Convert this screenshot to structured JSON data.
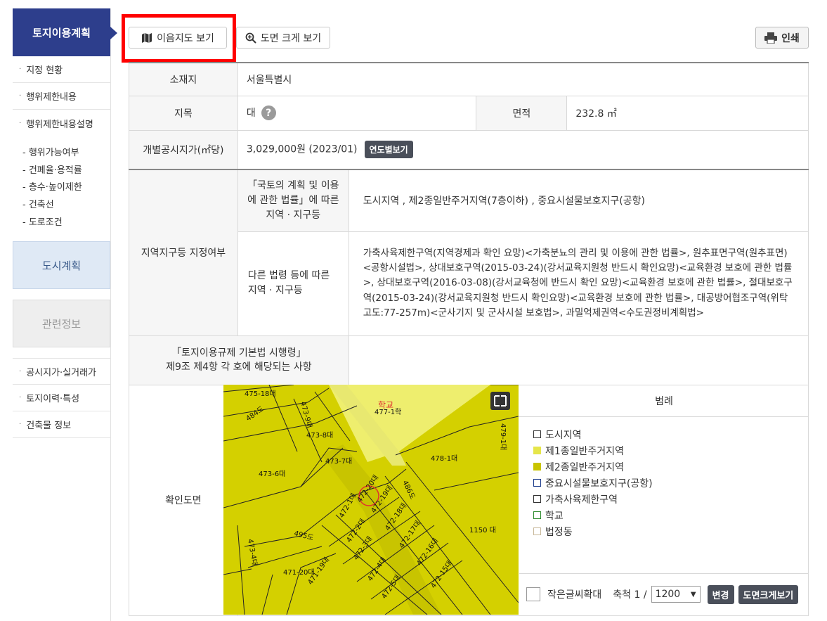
{
  "sidebar": {
    "header": "토지이용계획",
    "items_top": [
      "지정 현황",
      "행위제한내용",
      "행위제한내용설명"
    ],
    "sub_items": [
      "행위가능여부",
      "건폐율·용적률",
      "층수·높이제한",
      "건축선",
      "도로조건"
    ],
    "box_city": "도시계획",
    "box_related": "관련정보",
    "items_bottom": [
      "공시지가·실거래가",
      "토지이력·특성",
      "건축물 정보"
    ]
  },
  "toolbar": {
    "map_view": "이음지도 보기",
    "zoom_view": "도면 크게 보기",
    "print": "인쇄"
  },
  "table": {
    "loc_label": "소재지",
    "loc_value": "서울특별시",
    "jimok_label": "지목",
    "jimok_value": "대",
    "area_label": "면적",
    "area_value": "232.8 ㎡",
    "price_label": "개별공시지가(㎡당)",
    "price_value": "3,029,000원 (2023/01)",
    "price_button": "연도별보기",
    "zone_label": "지역지구등 지정여부",
    "law1_label": "「국토의 계획 및 이용에 관한 법률」에 따른 지역 · 지구등",
    "law1_value": "도시지역 , 제2종일반주거지역(7층이하) , 중요시설물보호지구(공항)",
    "law2_label": "다른 법령 등에 따른 지역 · 지구등",
    "law2_value": "가축사육제한구역(지역경제과 확인 요망)<가축분뇨의 관리 및 이용에 관한 법률>, 원추표면구역(원추표면)<공항시설법>, 상대보호구역(2015-03-24)(강서교육지원청 반드시 확인요망)<교육환경 보호에 관한 법률>, 상대보호구역(2016-03-08)(강서교육청에 반드시 확인 요망)<교육환경 보호에 관한 법률>, 절대보호구역(2015-03-24)(강서교육지원청 반드시 확인요망)<교육환경 보호에 관한 법률>, 대공방어협조구역(위탁고도:77-257m)<군사기지 및 군사시설 보호법>, 과밀억제권역<수도권정비계획법>",
    "rule_label_1": "「토지이용규제 기본법 시행령」",
    "rule_label_2": "제9조 제4항 각 호에 해당되는 사항",
    "rule_value": "",
    "map_label": "확인도면"
  },
  "legend": {
    "title": "범례",
    "items": [
      {
        "label": "도시지역",
        "color": "#ffffff",
        "border": "#333333"
      },
      {
        "label": "제1종일반주거지역",
        "color": "#e6e64a",
        "border": "#e6e64a"
      },
      {
        "label": "제2종일반주거지역",
        "color": "#c9c400",
        "border": "#c9c400"
      },
      {
        "label": "중요시설물보호지구(공항)",
        "color": "#ffffff",
        "border": "#1a3a8a"
      },
      {
        "label": "가축사육제한구역",
        "color": "#ffffff",
        "border": "#333333"
      },
      {
        "label": "학교",
        "color": "#ffffff",
        "border": "#2e8b2e"
      },
      {
        "label": "법정동",
        "color": "#ffffff",
        "border": "#c8b89a"
      }
    ],
    "small_text_zoom": "작은글씨확대",
    "scale_prefix": "축척 1 /",
    "scale_value": "1200",
    "change_button": "변경",
    "zoom_button": "도면크게보기"
  },
  "chart_data": {
    "type": "map",
    "map_labels": [
      "475-18대",
      "473-9대",
      "484도",
      "473-8대",
      "477-1학",
      "학교",
      "478-1대",
      "473-6대",
      "473-7대",
      "486도",
      "472-1대",
      "472-20대",
      "472-19대",
      "472-18대",
      "472-17대",
      "472-16대",
      "472-15대",
      "472-2대",
      "472-3대",
      "472-4대",
      "472-5대",
      "495도",
      "473-4대",
      "471-20대",
      "471-19대",
      "1150 대",
      "479-1대"
    ],
    "colors": {
      "zone2": "#d4d000",
      "zone1": "#eaea60",
      "road": "#e8e870",
      "line": "#222222",
      "marker": "#e03030"
    }
  }
}
